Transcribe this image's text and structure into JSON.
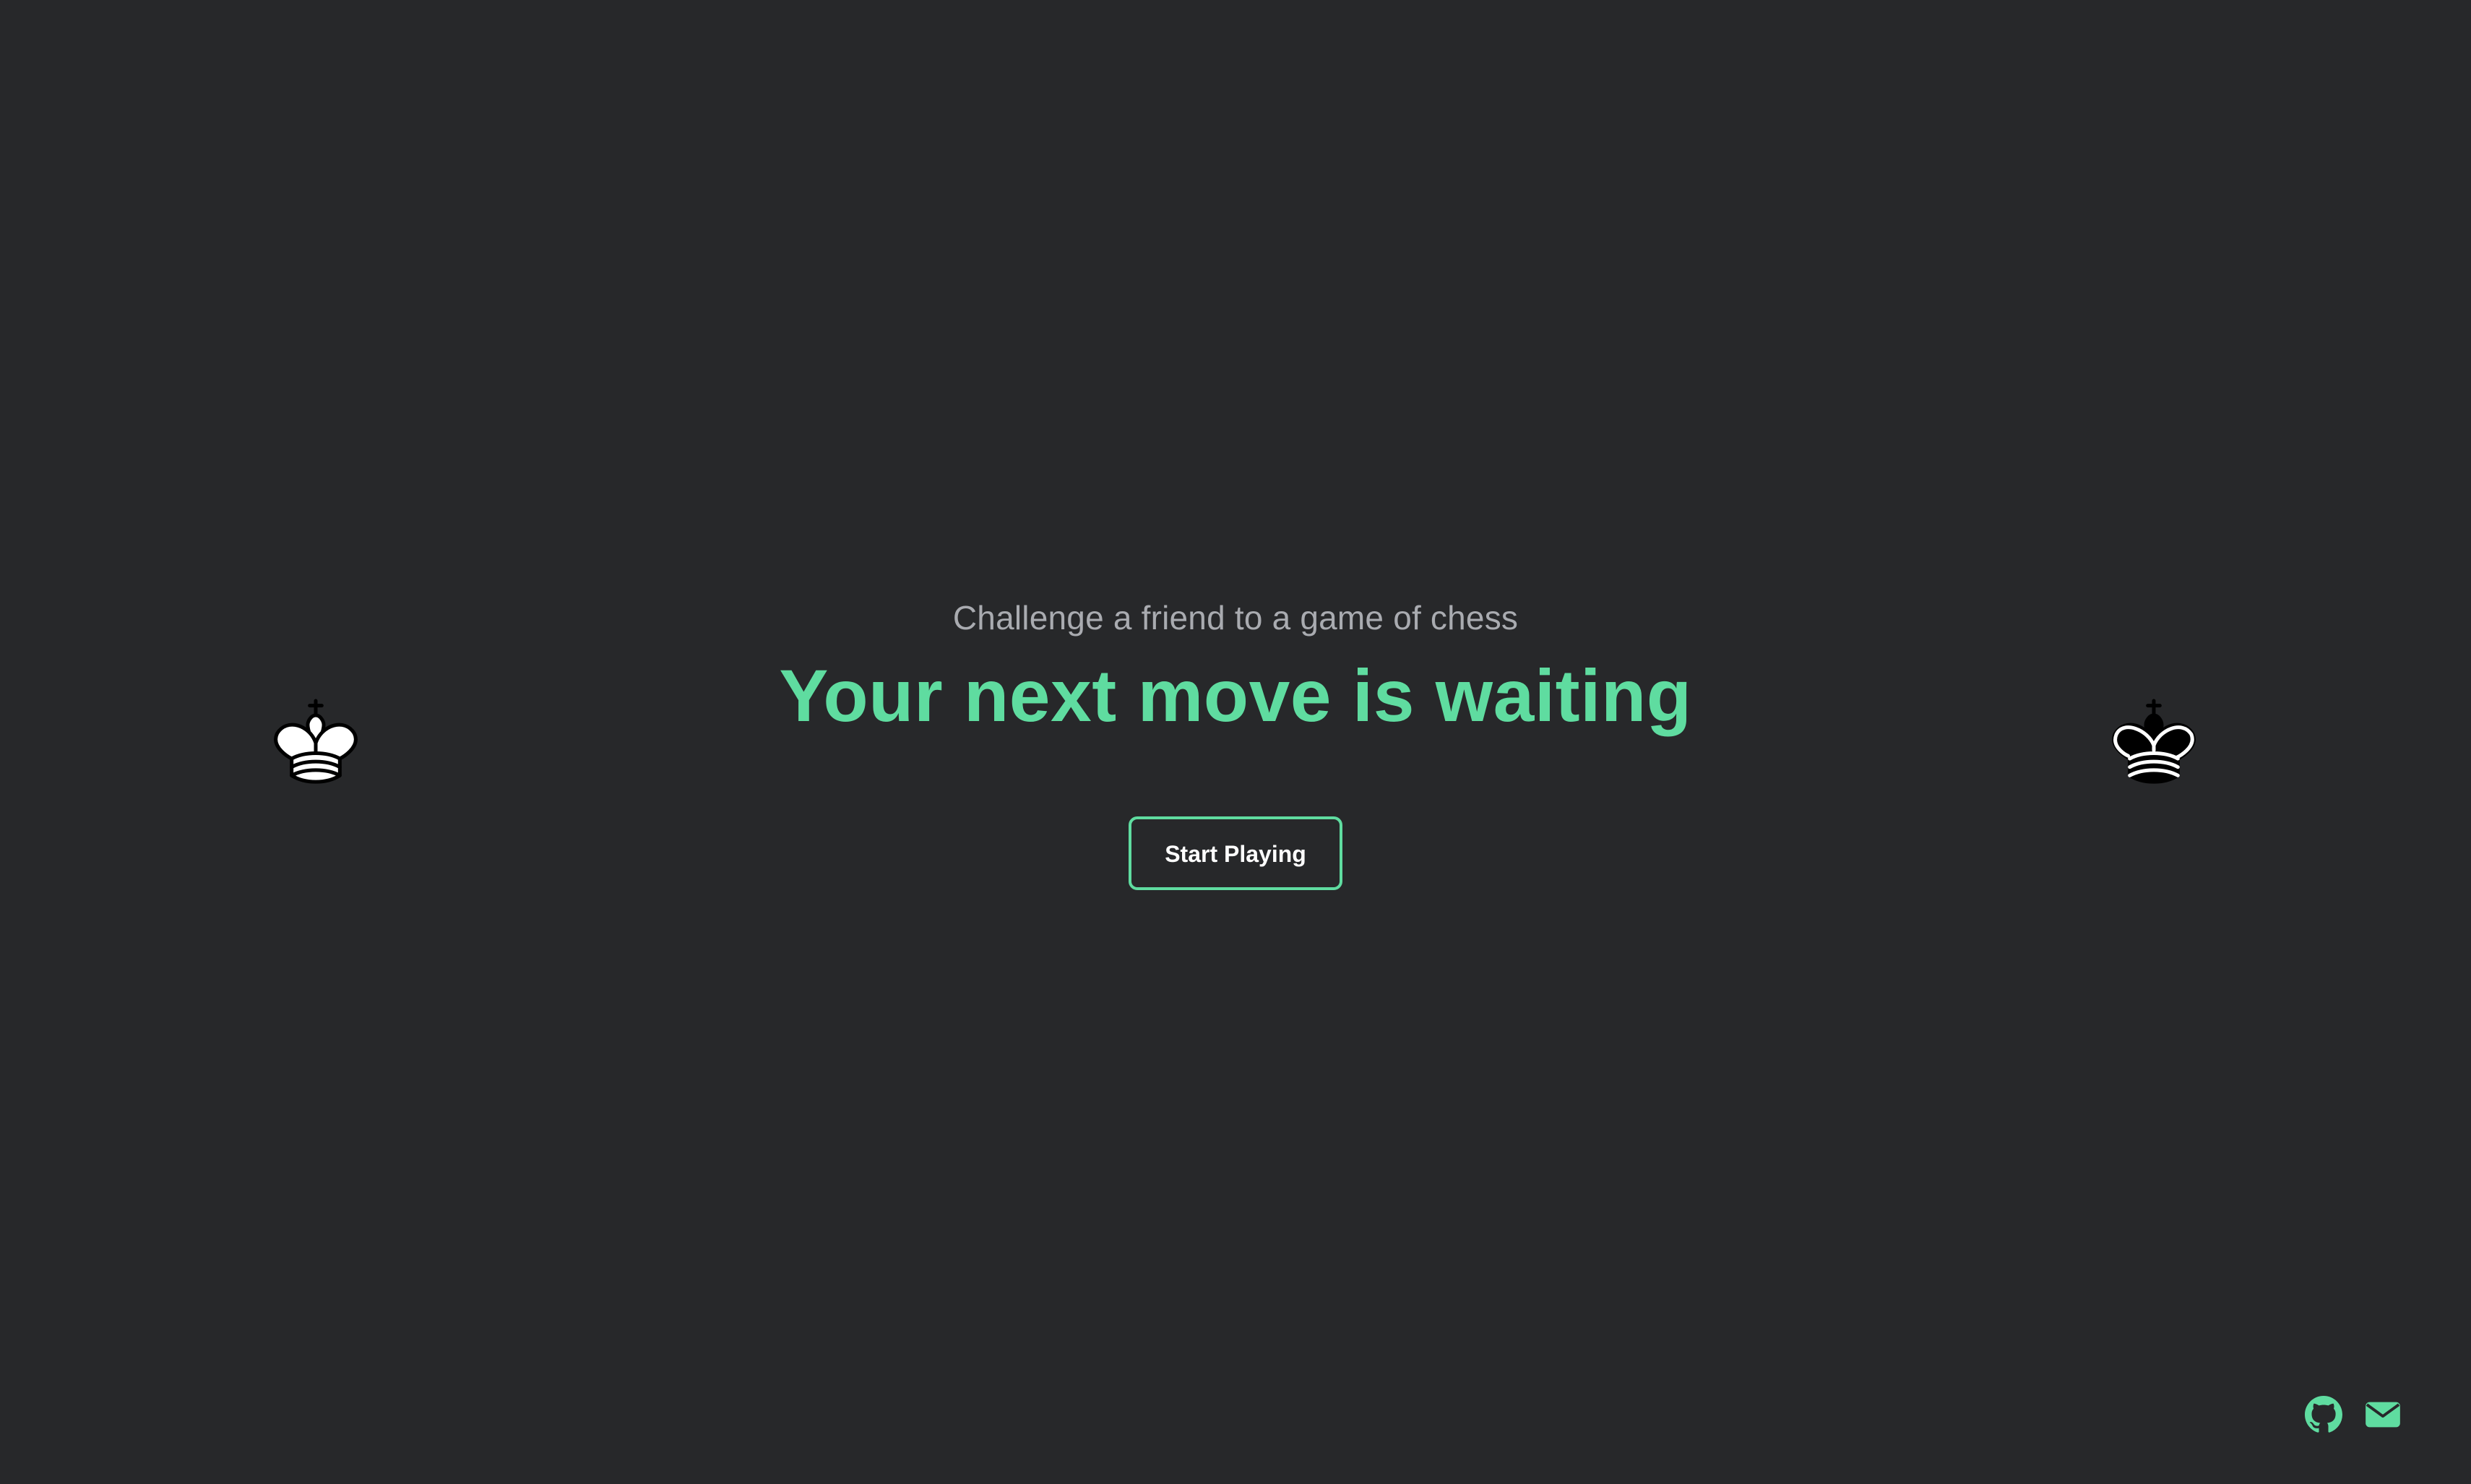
{
  "hero": {
    "subtitle": "Challenge a friend to a game of chess",
    "headline": "Your next move is waiting",
    "cta_label": "Start Playing"
  },
  "decorations": {
    "left_piece": "white-king-icon",
    "right_piece": "black-king-icon"
  },
  "footer": {
    "links": [
      {
        "icon": "github-icon"
      },
      {
        "icon": "mail-icon"
      }
    ]
  },
  "colors": {
    "background": "#27282a",
    "accent": "#5fdca0",
    "subtitle": "#a9abb0",
    "button_text": "#ffffff"
  }
}
